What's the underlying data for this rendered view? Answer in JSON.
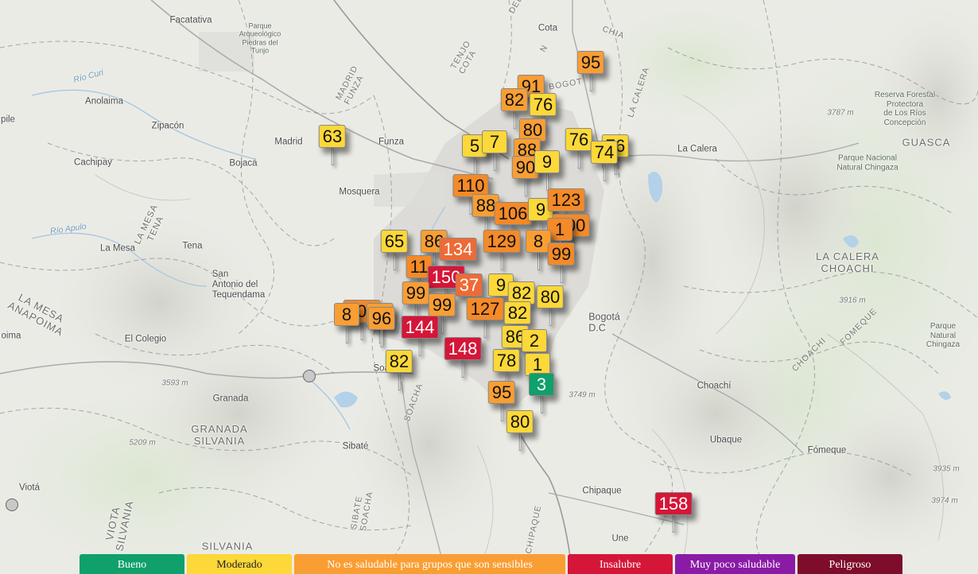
{
  "colors": {
    "good": "#10a06b",
    "moderate": "#fcd838",
    "usg": "#f99e33",
    "usg_dark": "#f58a27",
    "high": "#ee6a36",
    "unhealthy": "#d51638",
    "very_unhealthy": "#8a1ba6",
    "hazardous": "#7d0d2a"
  },
  "places": [
    {
      "id": "facatativa",
      "text": "Facatativa"
    },
    {
      "id": "parque-arqueologico",
      "text": "Parque\nArqueológico\nPiedras del\nTunjo"
    },
    {
      "id": "anolaima",
      "text": "Anolaima"
    },
    {
      "id": "zipacon",
      "text": "Zipacón"
    },
    {
      "id": "madrid",
      "text": "Madrid"
    },
    {
      "id": "funza",
      "text": "Funza"
    },
    {
      "id": "cachipay",
      "text": "Cachipay"
    },
    {
      "id": "bojaca",
      "text": "Bojacá"
    },
    {
      "id": "mosquera",
      "text": "Mosquera"
    },
    {
      "id": "la-mesa",
      "text": "La Mesa"
    },
    {
      "id": "tena",
      "text": "Tena"
    },
    {
      "id": "san-antonio",
      "text": "San\nAntonio del\nTequendama"
    },
    {
      "id": "el-colegio",
      "text": "El Colegio"
    },
    {
      "id": "soacha",
      "text": "Soacha"
    },
    {
      "id": "granada",
      "text": "Granada"
    },
    {
      "id": "sibate",
      "text": "Sibaté"
    },
    {
      "id": "viota",
      "text": "Viotá"
    },
    {
      "id": "bogota",
      "text": "Bogotá\nD.C"
    },
    {
      "id": "la-calera",
      "text": "La Calera"
    },
    {
      "id": "cota",
      "text": "Cota"
    },
    {
      "id": "choachi",
      "text": "Choachí"
    },
    {
      "id": "ubaque",
      "text": "Ubaque"
    },
    {
      "id": "fomeque",
      "text": "Fómeque"
    },
    {
      "id": "chipaque",
      "text": "Chipaque"
    },
    {
      "id": "une",
      "text": "Une"
    },
    {
      "id": "pile",
      "text": "pile"
    },
    {
      "id": "oima",
      "text": "oima"
    },
    {
      "id": "reserva",
      "text": "Reserva Forestal\nProtectora\nde Los Ríos\nConcepción"
    },
    {
      "id": "pnn-chingaza",
      "text": "Parque Nacional\nNatural Chingaza"
    },
    {
      "id": "pnn-chingaza-2",
      "text": "Parque\nNatural\nChingaza"
    }
  ],
  "regions": [
    {
      "id": "guasca",
      "text": "GUASCA"
    },
    {
      "id": "la-calera-choachi",
      "text": "LA CALERA\nCHOACHI"
    },
    {
      "id": "granada-silvania",
      "text": "GRANADA\nSILVANIA"
    },
    {
      "id": "silvania",
      "text": "SILVANIA"
    },
    {
      "id": "la-mesa-anapoima",
      "text": "LA MESA\nANAPOIMA"
    },
    {
      "id": "viota-silvania",
      "text": "VIOTA\nSILVANIA"
    },
    {
      "id": "la-mesa-tena",
      "text": "LA MESA\nTENA"
    }
  ],
  "roads": [
    {
      "id": "madrid-funza",
      "text": "MADRID\nFUNZA"
    },
    {
      "id": "tenjo-cota",
      "text": "TENJO\nCOTA"
    },
    {
      "id": "sibate-soacha",
      "text": "SIBATE\nSOACHA"
    },
    {
      "id": "soacha-road",
      "text": "SOACHA"
    },
    {
      "id": "chipaque-road",
      "text": "CHIPAQUE"
    },
    {
      "id": "chia-road",
      "text": "CHIA"
    },
    {
      "id": "choachi-road",
      "text": "CHOACHI"
    },
    {
      "id": "fomeque-road",
      "text": "FOMEQUE"
    },
    {
      "id": "calera-road",
      "text": "LA CALERA"
    },
    {
      "id": "bogota-road",
      "text": "BOGOT"
    },
    {
      "id": "cota-del",
      "text": "DEL"
    },
    {
      "id": "cota-sub",
      "text": "N"
    }
  ],
  "elevations": [
    {
      "id": "e3787",
      "text": "3787 m"
    },
    {
      "id": "e3916",
      "text": "3916 m"
    },
    {
      "id": "e3749",
      "text": "3749 m"
    },
    {
      "id": "e3593",
      "text": "3593 m"
    },
    {
      "id": "e5209",
      "text": "5209 m"
    },
    {
      "id": "e3935",
      "text": "3935 m"
    },
    {
      "id": "e3974",
      "text": "3974 m"
    }
  ],
  "rivers": [
    {
      "id": "rio-curi",
      "text": "Río Curi"
    },
    {
      "id": "rio-apulo",
      "text": "Río Apulo"
    }
  ],
  "markers": [
    {
      "v": "95",
      "c": "usg"
    },
    {
      "v": "91",
      "c": "usg"
    },
    {
      "v": "82",
      "c": "usg"
    },
    {
      "v": "76",
      "c": "moderate"
    },
    {
      "v": "80",
      "c": "usg"
    },
    {
      "v": "76",
      "c": "moderate"
    },
    {
      "v": "76",
      "c": "moderate"
    },
    {
      "v": "74",
      "c": "moderate"
    },
    {
      "v": "63",
      "c": "moderate"
    },
    {
      "v": "5",
      "c": "moderate"
    },
    {
      "v": "7",
      "c": "moderate"
    },
    {
      "v": "88",
      "c": "usg"
    },
    {
      "v": "90",
      "c": "usg"
    },
    {
      "v": "9",
      "c": "moderate"
    },
    {
      "v": "110",
      "c": "usg_dark"
    },
    {
      "v": "88",
      "c": "usg"
    },
    {
      "v": "106",
      "c": "usg_dark"
    },
    {
      "v": "9",
      "c": "moderate"
    },
    {
      "v": "123",
      "c": "usg_dark"
    },
    {
      "v": "100",
      "c": "usg_dark"
    },
    {
      "v": "1",
      "c": "usg_dark"
    },
    {
      "v": "65",
      "c": "moderate"
    },
    {
      "v": "86",
      "c": "usg"
    },
    {
      "v": "134",
      "c": "high"
    },
    {
      "v": "129",
      "c": "usg_dark"
    },
    {
      "v": "8",
      "c": "usg"
    },
    {
      "v": "99",
      "c": "usg_dark"
    },
    {
      "v": "11",
      "c": "usg_dark"
    },
    {
      "v": "150",
      "c": "unhealthy"
    },
    {
      "v": "37",
      "c": "high"
    },
    {
      "v": "9",
      "c": "moderate"
    },
    {
      "v": "99",
      "c": "usg"
    },
    {
      "v": "82",
      "c": "moderate"
    },
    {
      "v": "109",
      "c": "usg_dark"
    },
    {
      "v": "90",
      "c": "usg"
    },
    {
      "v": "8",
      "c": "usg"
    },
    {
      "v": "96",
      "c": "usg"
    },
    {
      "v": "99",
      "c": "usg"
    },
    {
      "v": "127",
      "c": "usg_dark"
    },
    {
      "v": "82",
      "c": "moderate"
    },
    {
      "v": "80",
      "c": "moderate"
    },
    {
      "v": "144",
      "c": "unhealthy"
    },
    {
      "v": "82",
      "c": "moderate"
    },
    {
      "v": "148",
      "c": "unhealthy"
    },
    {
      "v": "86",
      "c": "moderate"
    },
    {
      "v": "2",
      "c": "moderate"
    },
    {
      "v": "78",
      "c": "moderate"
    },
    {
      "v": "1",
      "c": "moderate"
    },
    {
      "v": "3",
      "c": "good"
    },
    {
      "v": "95",
      "c": "usg"
    },
    {
      "v": "80",
      "c": "moderate"
    },
    {
      "v": "158",
      "c": "unhealthy"
    }
  ],
  "legend": [
    {
      "label": "Bueno",
      "c": "good"
    },
    {
      "label": "Moderado",
      "c": "moderate"
    },
    {
      "label": "No es saludable para grupos que son sensibles",
      "c": "usg"
    },
    {
      "label": "Insalubre",
      "c": "unhealthy"
    },
    {
      "label": "Muy poco saludable",
      "c": "very_unhealthy"
    },
    {
      "label": "Peligroso",
      "c": "hazardous"
    }
  ]
}
